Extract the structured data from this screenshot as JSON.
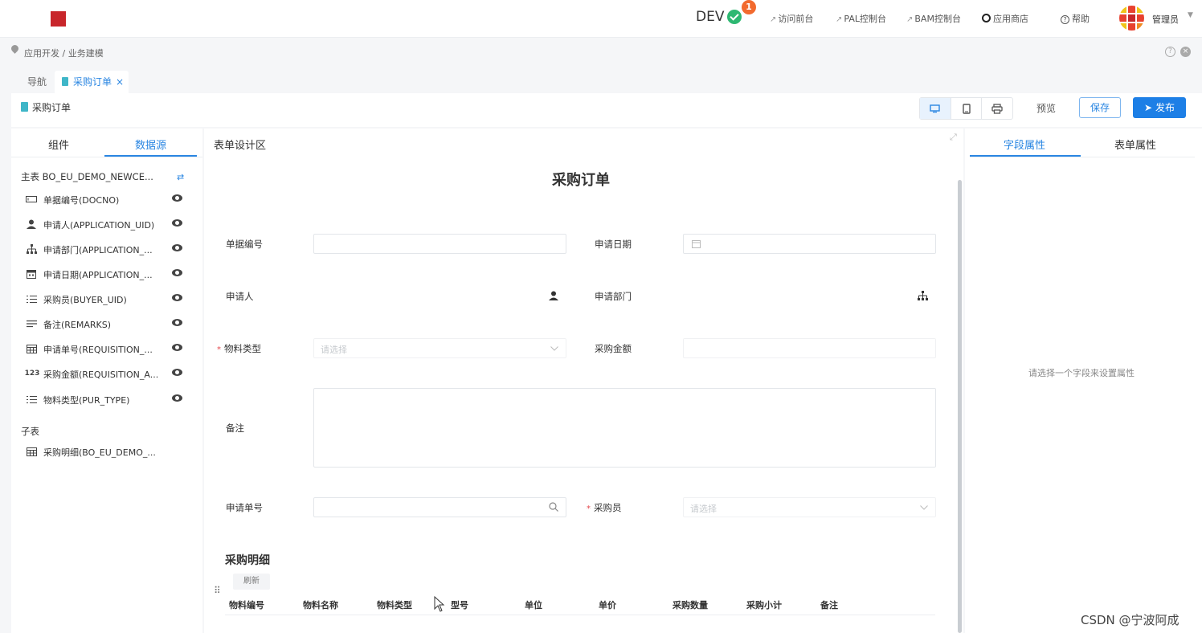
{
  "topbar": {
    "env": "DEV",
    "notification_count": "1",
    "links": [
      {
        "label": "访问前台"
      },
      {
        "label": "PAL控制台"
      },
      {
        "label": "BAM控制台"
      },
      {
        "label": "应用商店"
      },
      {
        "label": "帮助"
      }
    ],
    "user": "管理员",
    "colors": {
      "logo": "#c8262b",
      "check": "#2eb872",
      "badge": "#f26a2e"
    }
  },
  "breadcrumb": "应用开发 / 业务建模",
  "tabs": {
    "nav": "导航",
    "active": "采购订单"
  },
  "toolbar": {
    "title": "采购订单",
    "preview": "预览",
    "save": "保存",
    "publish": "发布",
    "device_icons": [
      "desktop-icon",
      "tablet-icon",
      "print-icon"
    ]
  },
  "left_panel": {
    "tabs": [
      "组件",
      "数据源"
    ],
    "active_tab": "数据源",
    "main_table": "主表 BO_EU_DEMO_NEWCE...",
    "fields": [
      {
        "icon": "textbox-icon",
        "label": "单据编号(DOCNO)"
      },
      {
        "icon": "user-icon",
        "label": "申请人(APPLICATION_UID)"
      },
      {
        "icon": "org-icon",
        "label": "申请部门(APPLICATION_..."
      },
      {
        "icon": "calendar-icon",
        "label": "申请日期(APPLICATION_..."
      },
      {
        "icon": "list-icon",
        "label": "采购员(BUYER_UID)"
      },
      {
        "icon": "lines-icon",
        "label": "备注(REMARKS)"
      },
      {
        "icon": "table-icon",
        "label": "申请单号(REQUISITION_..."
      },
      {
        "icon": "number-icon",
        "label": "采购金额(REQUISITION_A..."
      },
      {
        "icon": "list-icon",
        "label": "物料类型(PUR_TYPE)"
      }
    ],
    "sub_label": "子表",
    "sub_tables": [
      {
        "icon": "table-icon",
        "label": "采购明细(BO_EU_DEMO_..."
      }
    ]
  },
  "design": {
    "area_title": "表单设计区",
    "form_title": "采购订单",
    "labels": {
      "docno": "单据编号",
      "apply_date": "申请日期",
      "applicant": "申请人",
      "dept": "申请部门",
      "material_type": "物料类型",
      "amount": "采购金额",
      "remarks": "备注",
      "req_no": "申请单号",
      "buyer": "采购员"
    },
    "required_mark": "*",
    "placeholders": {
      "material_type": "请选择",
      "buyer": "请选择"
    },
    "detail_title": "采购明细",
    "refresh": "刷新",
    "columns": [
      "物料编号",
      "物料名称",
      "物料类型",
      "型号",
      "单位",
      "单价",
      "采购数量",
      "采购小计",
      "备注"
    ]
  },
  "right_panel": {
    "tabs": [
      "字段属性",
      "表单属性"
    ],
    "active_tab": "字段属性",
    "hint": "请选择一个字段来设置属性"
  },
  "watermark": "CSDN @宁波阿成",
  "accent_color": "#2a86e2"
}
